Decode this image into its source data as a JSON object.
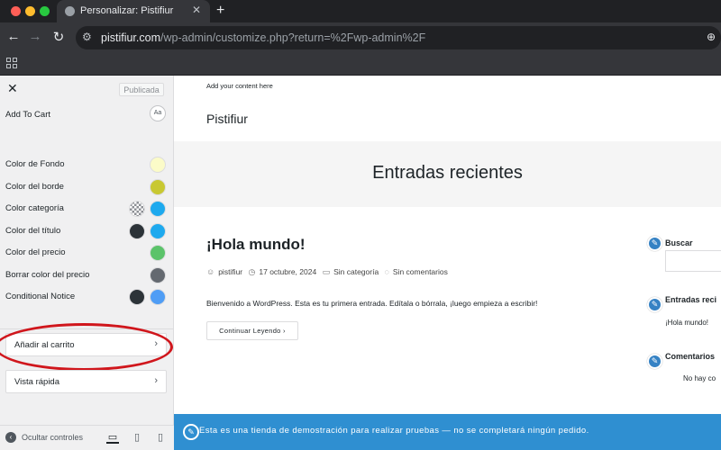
{
  "browser": {
    "tab_title": "Personalizar: Pistifiur",
    "tab_close": "✕",
    "new_tab": "+",
    "url_host": "pistifiur.com",
    "url_path": "/wp-admin/customize.php?return=%2Fwp-admin%2F"
  },
  "sidebar": {
    "publish_label": "Publicada",
    "add_to_cart_label": "Add To Cart",
    "font_button": "Aa",
    "color_rows": [
      {
        "label": "Color de Fondo",
        "colors": [
          "#fbfbc8"
        ]
      },
      {
        "label": "Color del borde",
        "colors": [
          "#c8c832"
        ]
      },
      {
        "label": "Color categoría",
        "colors": [
          "checkered",
          "#1da9ee"
        ]
      },
      {
        "label": "Color del título",
        "colors": [
          "#2c3338",
          "#1da9ee"
        ]
      },
      {
        "label": "Color del precio",
        "colors": [
          "#5bc36a"
        ]
      },
      {
        "label": "Borrar color del precio",
        "colors": [
          "#646970"
        ]
      },
      {
        "label": "Conditional Notice",
        "colors": [
          "#2c3338",
          "#4f9df5"
        ]
      }
    ],
    "panels": [
      {
        "label": "Añadir al carrito",
        "chevron": "›"
      },
      {
        "label": "Vista rápida",
        "chevron": "›"
      }
    ],
    "hide_controls_label": "Ocultar controles"
  },
  "preview": {
    "top_note": "Add your content here",
    "site_title": "Pistifiur",
    "hero_title": "Entradas recientes",
    "post": {
      "title": "¡Hola mundo!",
      "author": "pistifiur",
      "date": "17 octubre, 2024",
      "category": "Sin categoría",
      "comments": "Sin comentarios",
      "excerpt": "Bienvenido a WordPress. Esta es tu primera entrada. Edítala o bórrala, ¡luego empieza a escribir!",
      "read_more": "Continuar Leyendo ›"
    },
    "widgets": {
      "search_title": "Buscar",
      "recent_title": "Entradas reci",
      "recent_item": "¡Hola mundo!",
      "comments_title": "Comentarios",
      "comments_text": "No hay co"
    },
    "banner_text": "Esta es una tienda de demostración para realizar pruebas — no se completará ningún pedido."
  },
  "colors": {
    "highlight": "#d0161c",
    "banner": "#2f8fd1",
    "edit_pencil": "#3582c4"
  }
}
